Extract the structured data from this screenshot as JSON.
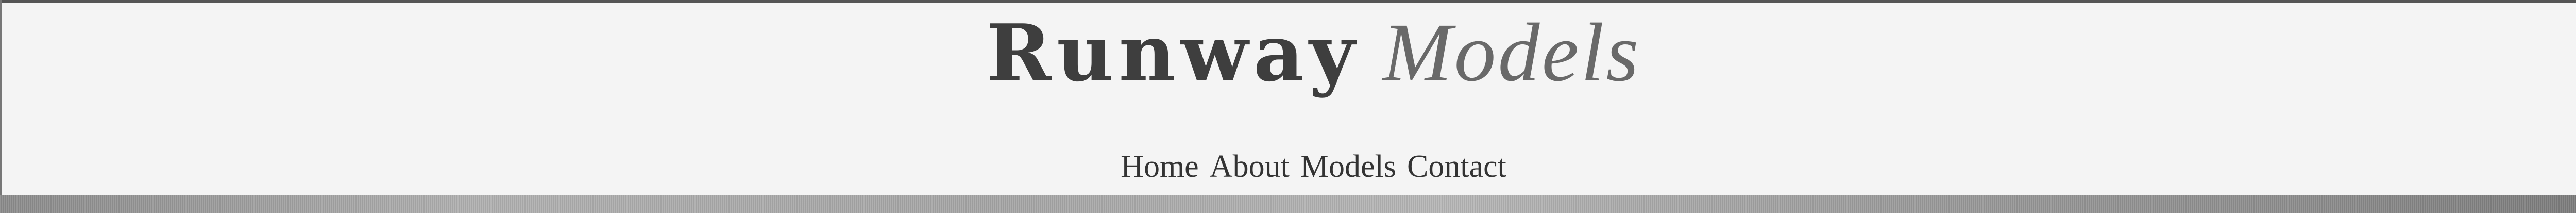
{
  "brand": {
    "name_primary": "Runway",
    "name_secondary": "Models"
  },
  "nav": {
    "items": [
      {
        "label": "Home",
        "active": true
      },
      {
        "label": "About",
        "active": false
      },
      {
        "label": "Models",
        "active": false
      },
      {
        "label": "Contact",
        "active": false
      }
    ]
  },
  "colors": {
    "header_background": "#f4f4f4",
    "logo_primary": "#3e3e3e",
    "logo_secondary": "#696969",
    "nav_text": "#333333",
    "active_underline": "#4a4a4a"
  }
}
